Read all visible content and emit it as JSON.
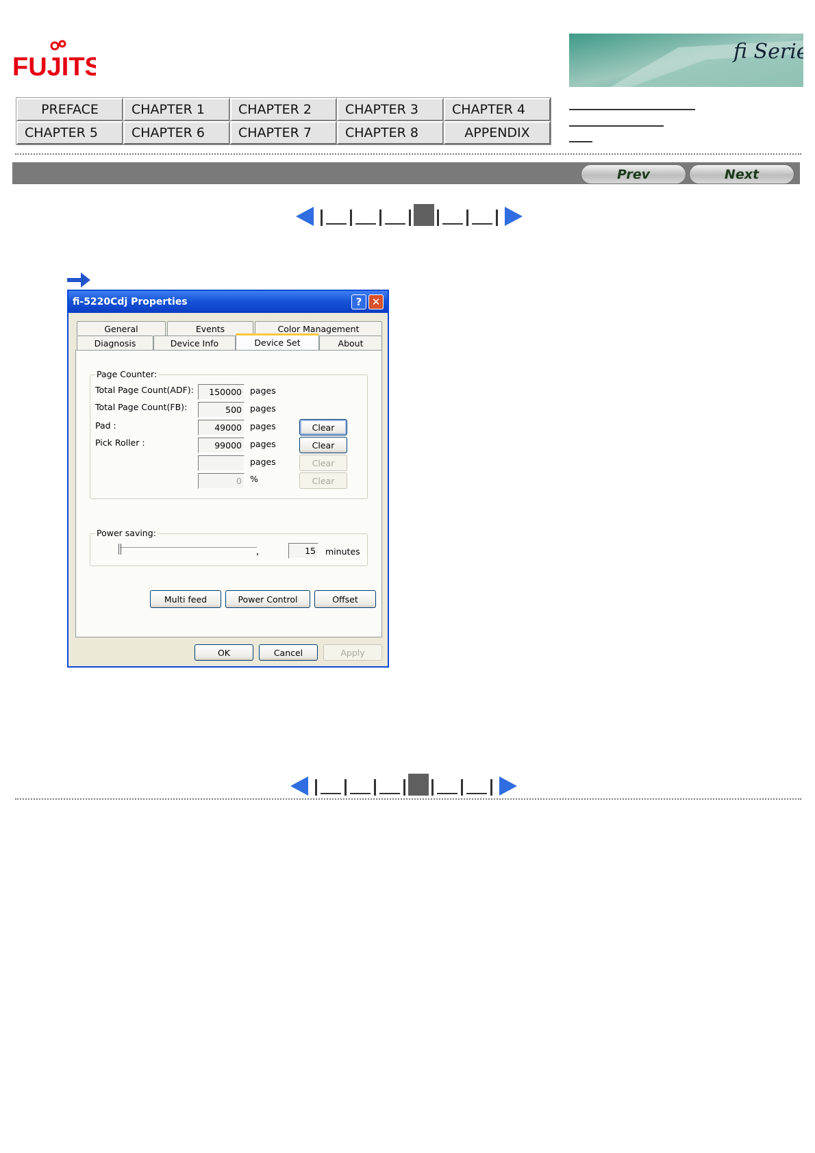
{
  "header": {
    "logo_text": "FUJITSU",
    "banner_text": "fi Series"
  },
  "nav": {
    "row1": [
      "PREFACE",
      "CHAPTER 1",
      "CHAPTER 2",
      "CHAPTER 3",
      "CHAPTER 4"
    ],
    "row2": [
      "CHAPTER 5",
      "CHAPTER 6",
      "CHAPTER 7",
      "CHAPTER 8",
      "APPENDIX"
    ]
  },
  "pager": {
    "prev": "Prev",
    "next": "Next"
  },
  "dialog": {
    "title": "fi-5220Cdj Properties",
    "help_glyph": "?",
    "close_glyph": "✕",
    "tabs_row1": [
      "General",
      "Events",
      "Color Management"
    ],
    "tabs_row2": [
      "Diagnosis",
      "Device Info",
      "Device Set",
      "About"
    ],
    "page_counter": {
      "label": "Page Counter:",
      "rows": [
        {
          "label": "Total Page Count(ADF):",
          "value": "150000",
          "unit": "pages"
        },
        {
          "label": "Total Page Count(FB):",
          "value": "500",
          "unit": "pages"
        },
        {
          "label": "Pad :",
          "value": "49000",
          "unit": "pages",
          "button": "Clear"
        },
        {
          "label": "Pick Roller :",
          "value": "99000",
          "unit": "pages",
          "button": "Clear"
        },
        {
          "label": "",
          "value": "",
          "unit": "pages",
          "button": "Clear"
        },
        {
          "label": "",
          "value": "0",
          "unit": "%",
          "button": "Clear"
        }
      ]
    },
    "power_saving": {
      "label": "Power saving:",
      "value": "15",
      "unit": "minutes",
      "level": 0.0
    },
    "buttons_mid": [
      "Multi feed",
      "Power Control",
      "Offset"
    ],
    "buttons_bottom": [
      "OK",
      "Cancel",
      "Apply"
    ]
  }
}
